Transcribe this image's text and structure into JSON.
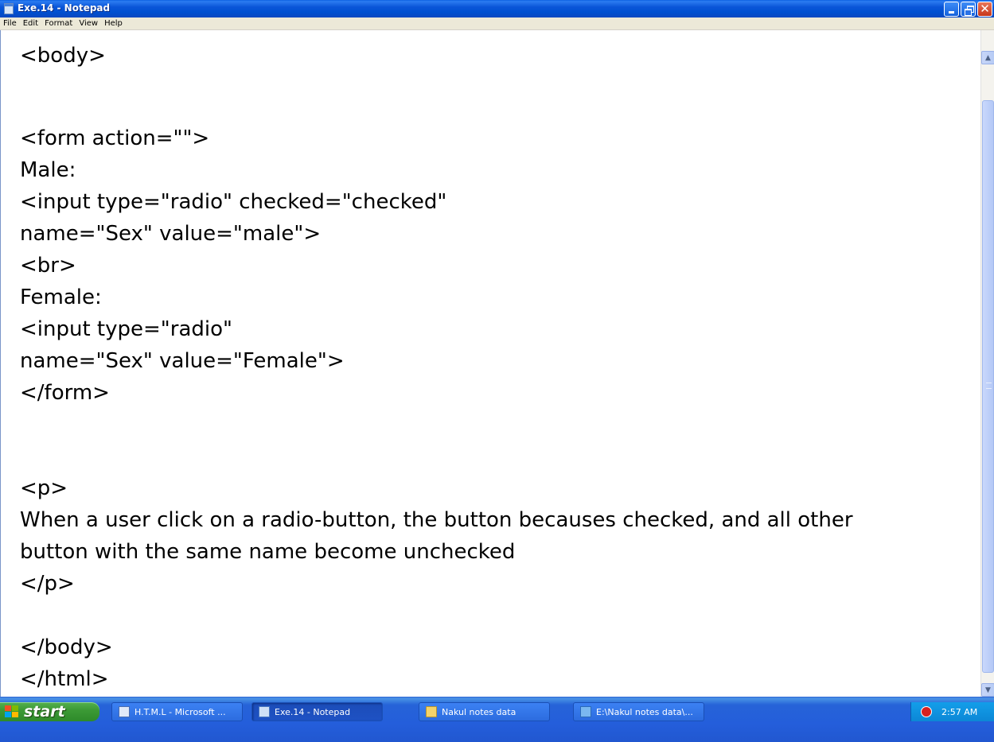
{
  "window": {
    "title": "Exe.14 - Notepad",
    "buttons": {
      "minimize": "minimize",
      "maximize": "restore",
      "close": "close"
    }
  },
  "menubar": {
    "items": [
      {
        "label": "File"
      },
      {
        "label": "Edit"
      },
      {
        "label": "Format"
      },
      {
        "label": "View"
      },
      {
        "label": "Help"
      }
    ]
  },
  "editor": {
    "lines": [
      "<body>",
      "",
      "<form action=\"\">",
      "Male:",
      "<input type=\"radio\" checked=\"checked\"",
      "name=\"Sex\" value=\"male\">",
      "<br>",
      "Female:",
      "<input type=\"radio\"",
      "name=\"Sex\" value=\"Female\">",
      "</form>",
      "",
      "<p>",
      "When a user click on a radio-button, the button becauses checked, and all other",
      "button with the same name become unchecked",
      "</p>",
      "",
      "</body>",
      "</html>"
    ]
  },
  "taskbar": {
    "start_label": "start",
    "tasks": [
      {
        "label": "H.T.M.L - Microsoft ...",
        "icon": "word-icon",
        "active": false
      },
      {
        "label": "Exe.14 - Notepad",
        "icon": "notepad-icon",
        "active": true
      },
      {
        "label": "Nakul notes data",
        "icon": "folder-icon",
        "active": false
      },
      {
        "label": "E:\\Nakul notes data\\...",
        "icon": "ie-icon",
        "active": false
      }
    ],
    "tray": {
      "time": "2:57 AM",
      "icon": "security-shield-icon"
    }
  },
  "colors": {
    "titlebar": "#0a55d8",
    "menubar": "#ece9d8",
    "taskbar": "#245edb",
    "start_button": "#3c9a36",
    "tray": "#0c87d6"
  }
}
